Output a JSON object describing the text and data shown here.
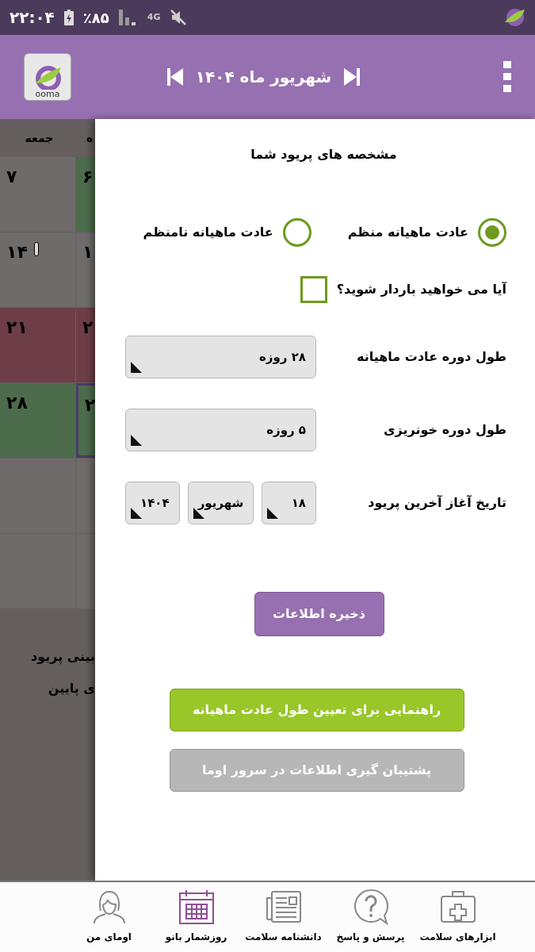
{
  "status_bar": {
    "time": "۲۲:۰۴",
    "battery": "٪۸۵",
    "network": "4G"
  },
  "header": {
    "logo_text": "ooma",
    "title": "شهریور ماه ۱۴۰۴"
  },
  "calendar": {
    "columns": [
      "ه",
      "جمعه"
    ],
    "rows": [
      {
        "cells": [
          {
            "text": "۶",
            "kind": "green",
            "today": false
          },
          {
            "text": "۷",
            "kind": "plain",
            "flag": false,
            "today": false
          }
        ]
      },
      {
        "cells": [
          {
            "text": "۱",
            "kind": "plain",
            "today": false
          },
          {
            "text": "۱۴",
            "kind": "plain",
            "flag": true,
            "today": false
          }
        ]
      },
      {
        "cells": [
          {
            "text": "۲",
            "kind": "red",
            "today": false
          },
          {
            "text": "۲۱",
            "kind": "red",
            "flag": false,
            "today": false
          }
        ]
      },
      {
        "cells": [
          {
            "text": "۲",
            "kind": "green",
            "today": true
          },
          {
            "text": "۲۸",
            "kind": "green",
            "flag": false,
            "today": false
          }
        ]
      },
      {
        "cells": [
          {
            "kind": "plain",
            "today": false
          },
          {
            "kind": "plain",
            "flag": false,
            "today": false
          }
        ]
      },
      {
        "cells": [
          {
            "kind": "plain",
            "today": false
          },
          {
            "kind": "plain",
            "flag": false,
            "today": false
          }
        ]
      }
    ],
    "notes": [
      "بینی پریود",
      "ی پایین"
    ]
  },
  "panel": {
    "title": "مشخصه های پریود شما",
    "radios": [
      {
        "label": "عادت ماهیانه منظم",
        "selected": true
      },
      {
        "label": "عادت ماهیانه نامنظم",
        "selected": false
      }
    ],
    "pregnancy": {
      "label": "آیا می خواهید باردار شوید؟",
      "checked": false
    },
    "fields": [
      {
        "label": "طول دوره عادت ماهیانه",
        "values": [
          "۲۸ روزه"
        ]
      },
      {
        "label": "طول دوره خونریزی",
        "values": [
          "۵ روزه"
        ]
      },
      {
        "label": "تاریخ آغاز آخرین پریود",
        "values": [
          "۱۸",
          "شهریور",
          "۱۴۰۴"
        ]
      }
    ],
    "save_button": "ذخیره اطلاعات",
    "guide_button": "راهنمایی برای تعیین طول عادت ماهیانه",
    "backup_button": "پشتیبان گیری اطلاعات در سرور اوما"
  },
  "bottom_nav": [
    {
      "label": "ابزارهای سلامت",
      "kind": "kit",
      "selected": false
    },
    {
      "label": "پرسش و پاسخ",
      "kind": "question",
      "selected": false
    },
    {
      "label": "دانشنامه سلامت",
      "kind": "news",
      "selected": false
    },
    {
      "label": "روزشمار بانو",
      "kind": "calendar",
      "selected": true
    },
    {
      "label": "اومای من",
      "kind": "person",
      "selected": false
    }
  ]
}
